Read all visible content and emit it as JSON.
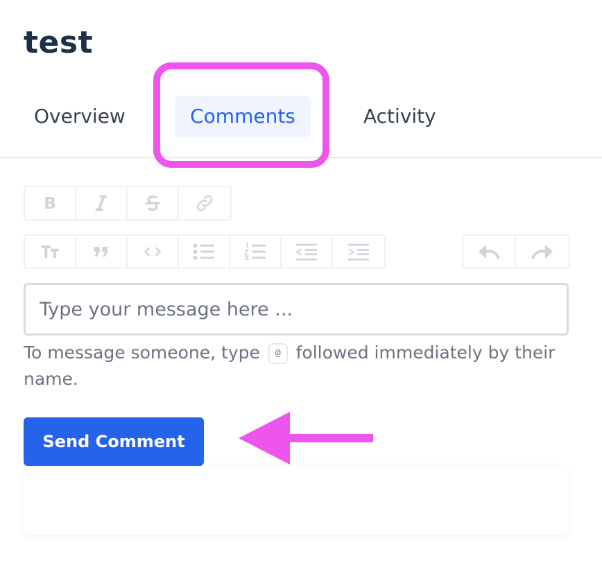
{
  "page": {
    "title": "test"
  },
  "tabs": [
    {
      "label": "Overview",
      "active": false
    },
    {
      "label": "Comments",
      "active": true
    },
    {
      "label": "Activity",
      "active": false
    }
  ],
  "toolbar": {
    "row1": [
      "bold-icon",
      "italic-icon",
      "strikethrough-icon",
      "link-icon"
    ],
    "row2": [
      "heading-icon",
      "quote-icon",
      "code-icon",
      "bullet-list-icon",
      "numbered-list-icon",
      "outdent-icon",
      "indent-icon"
    ],
    "history": [
      "undo-icon",
      "redo-icon"
    ]
  },
  "composer": {
    "placeholder": "Type your message here ...",
    "helper_before": "To message someone, type",
    "helper_key": "@",
    "helper_after": "followed immediately by their name.",
    "send_label": "Send Comment"
  },
  "colors": {
    "accent": "#2563eb",
    "annotation": "#ee55ee",
    "active_tab_bg": "#eff4ff"
  }
}
